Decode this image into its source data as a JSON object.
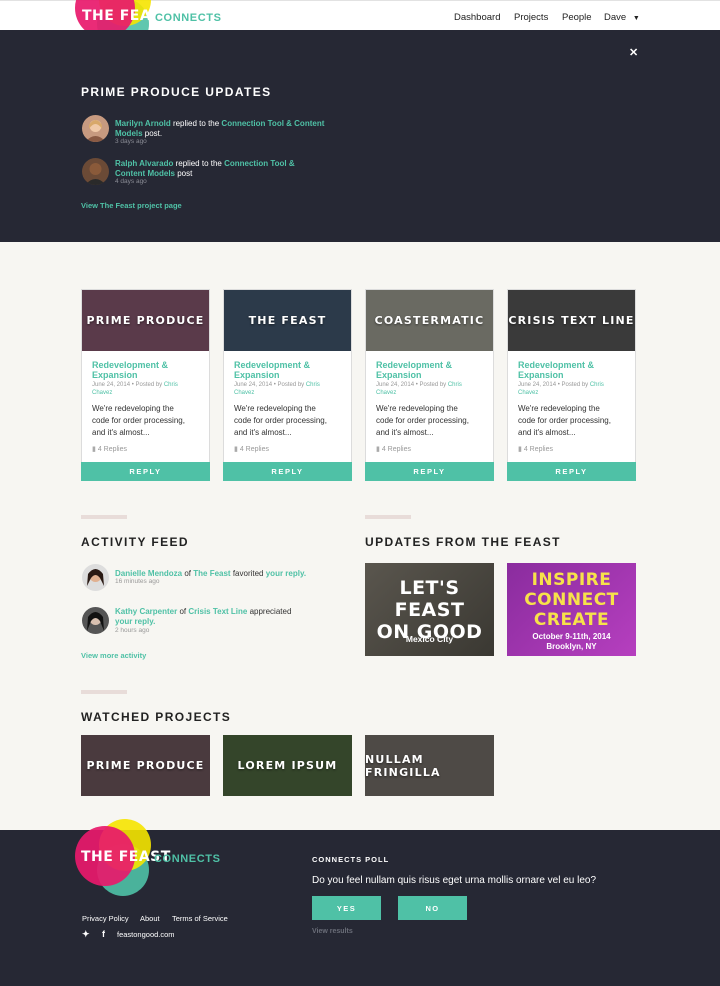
{
  "nav": {
    "brand": "THE FEAST",
    "connects": "CONNECTS",
    "items": [
      "Dashboard",
      "Projects",
      "People",
      "Dave"
    ]
  },
  "updates": {
    "title": "PRIME PRODUCE UPDATES",
    "entries": [
      {
        "name": "Marilyn Arnold",
        "verb": " replied to the ",
        "target1": "Connection Tool & Content",
        "target2": "Models",
        "suffix": " post.",
        "time": "3 days ago"
      },
      {
        "name": "Ralph Alvarado",
        "verb": " replied to the ",
        "target1": "Connection Tool &",
        "target2": "Content Models",
        "suffix": " post",
        "time": "4 days ago"
      }
    ],
    "link": "View The Feast project page"
  },
  "cards": [
    {
      "label": "PRIME PRODUCE",
      "title1": "Redevelopment &",
      "title2": "Expansion",
      "date": "June 24, 2014",
      "posted_by": "Posted by",
      "author1": "Chris",
      "author2": "Chavez",
      "body1": "We're redeveloping the",
      "body2": "code for order processing,",
      "body3": "and it's almost...",
      "replies": "4 Replies",
      "button": "REPLY",
      "bg": "#5a3a4a"
    },
    {
      "label": "THE FEAST",
      "title1": "Redevelopment &",
      "title2": "Expansion",
      "date": "June 24, 2014",
      "posted_by": "Posted by",
      "author1": "Chris",
      "author2": "Chavez",
      "body1": "We're redeveloping the",
      "body2": "code for order processing,",
      "body3": "and it's almost...",
      "replies": "4 Replies",
      "button": "REPLY",
      "bg": "#2c3a4a"
    },
    {
      "label": "COASTERMATIC",
      "title1": "Redevelopment &",
      "title2": "Expansion",
      "date": "June 24, 2014",
      "posted_by": "Posted by",
      "author1": "Chris",
      "author2": "Chavez",
      "body1": "We're redeveloping the",
      "body2": "code for order processing,",
      "body3": "and it's almost...",
      "replies": "4 Replies",
      "button": "REPLY",
      "bg": "#6a6a62"
    },
    {
      "label": "CRISIS TEXT LINE",
      "title1": "Redevelopment &",
      "title2": "Expansion",
      "date": "June 24, 2014",
      "posted_by": "Posted by",
      "author1": "Chris",
      "author2": "Chavez",
      "body1": "We're redeveloping the",
      "body2": "code for order processing,",
      "body3": "and it's almost...",
      "replies": "4 Replies",
      "button": "REPLY",
      "bg": "#3a3a3a"
    }
  ],
  "activity": {
    "title": "ACTIVITY FEED",
    "entries": [
      {
        "name": "Danielle Mendoza",
        "of": " of ",
        "project": "The Feast",
        "verb": " favorited ",
        "target": "your reply.",
        "time": "16 minutes ago"
      },
      {
        "name": "Kathy Carpenter",
        "of": " of ",
        "project": "Crisis Text Line",
        "verb": " appreciated",
        "target": "your reply.",
        "time": "2 hours ago"
      }
    ],
    "link": "View more activity"
  },
  "feast_updates": {
    "title": "UPDATES FROM THE FEAST",
    "promo1": {
      "line1": "LET'S FEAST",
      "line2": "ON GOOD",
      "sub": "Mexico City"
    },
    "promo2": {
      "line1": "INSPIRE",
      "line2": "CONNECT",
      "line3": "CREATE",
      "sub1": "October 9-11th, 2014",
      "sub2": "Brooklyn, NY"
    }
  },
  "watched": {
    "title": "WATCHED PROJECTS",
    "items": [
      {
        "label": "PRIME PRODUCE",
        "bg": "#4a3a3e"
      },
      {
        "label": "LOREM IPSUM",
        "bg": "#34452a"
      },
      {
        "label": "NULLAM FRINGILLA",
        "bg": "#4e4a46"
      }
    ]
  },
  "footer": {
    "links": [
      "Privacy Policy",
      "About",
      "Terms of Service"
    ],
    "site": "feastongood.com",
    "poll_title": "CONNECTS POLL",
    "poll_question": "Do you feel nullam quis risus eget urna mollis ornare vel eu leo?",
    "yes": "YES",
    "no": "NO",
    "results": "View results"
  },
  "colors": {
    "accent": "#4fc1a6",
    "dark": "#262834",
    "brand_pink": "#e8196b",
    "brand_yellow": "#f5e400"
  }
}
